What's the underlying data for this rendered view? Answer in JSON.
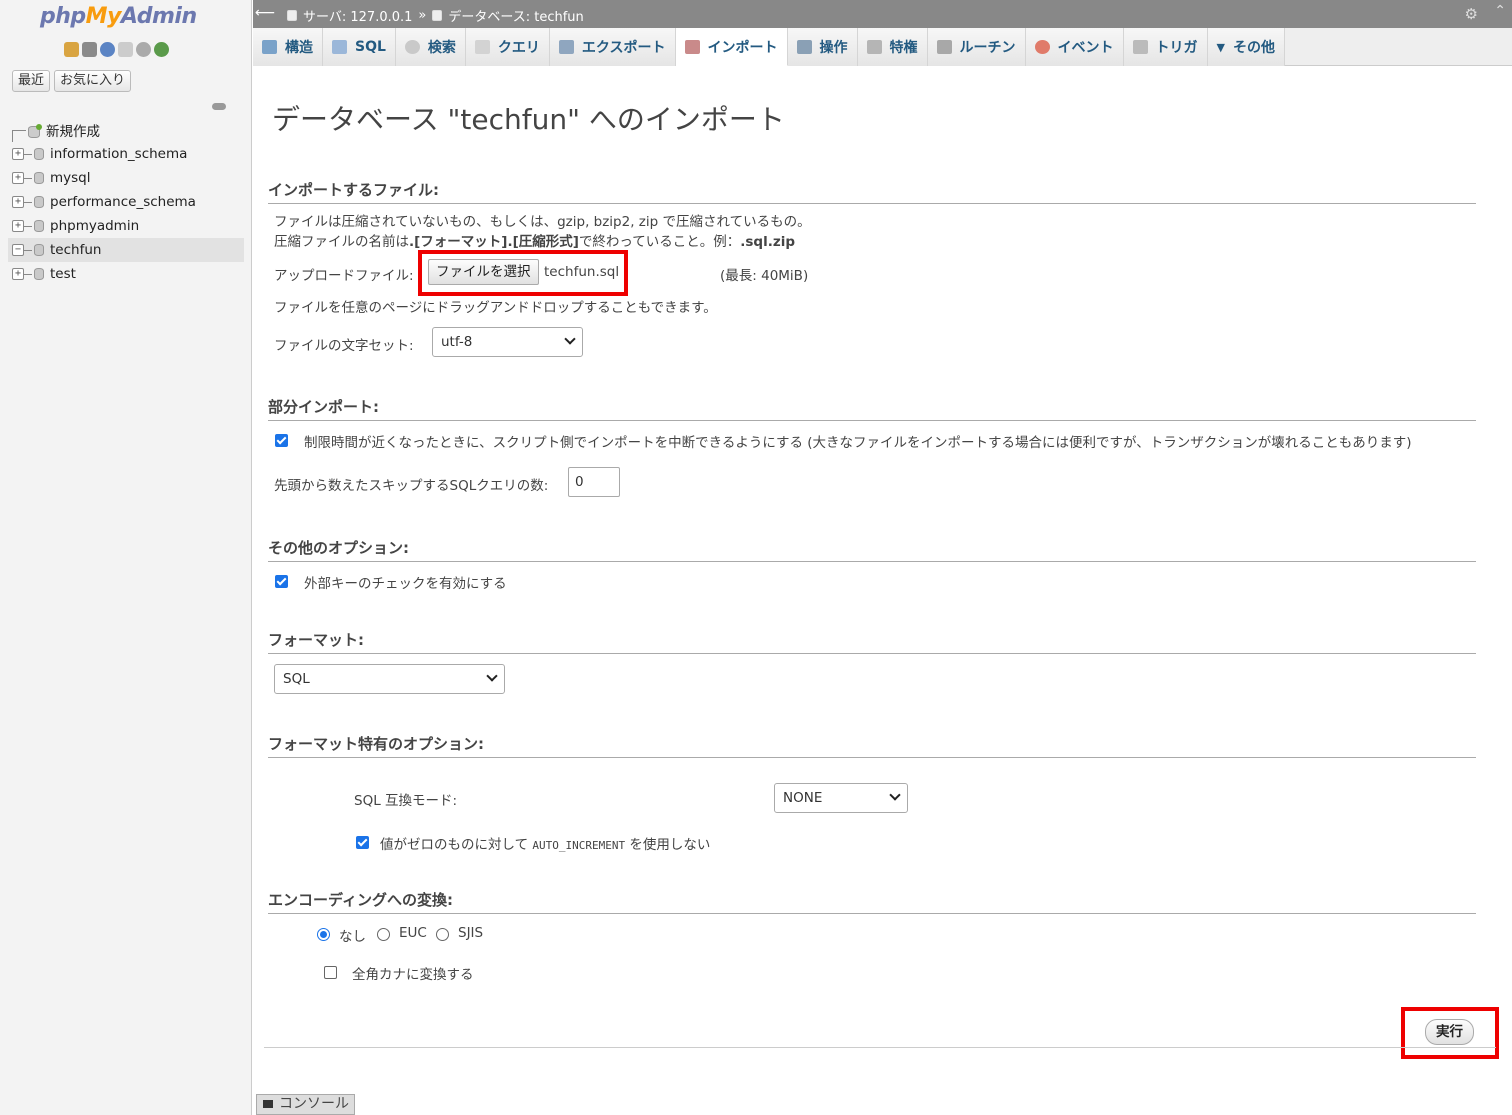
{
  "sidebar": {
    "logo": {
      "php": "php",
      "my": "My",
      "admin": "Admin"
    },
    "recent_label": "最近",
    "favorites_label": "お気に入り",
    "new_label": "新規作成",
    "databases": [
      {
        "name": "information_schema"
      },
      {
        "name": "mysql"
      },
      {
        "name": "performance_schema"
      },
      {
        "name": "phpmyadmin"
      },
      {
        "name": "techfun",
        "selected": true
      },
      {
        "name": "test"
      }
    ]
  },
  "topbar": {
    "server": "サーバ: 127.0.0.1",
    "separator": "»",
    "database": "データベース: techfun"
  },
  "menu": {
    "structure": "構造",
    "sql": "SQL",
    "search": "検索",
    "query": "クエリ",
    "export": "エクスポート",
    "import": "インポート",
    "operations": "操作",
    "privileges": "特権",
    "routines": "ルーチン",
    "events": "イベント",
    "triggers": "トリガ",
    "more": "その他"
  },
  "main": {
    "title": "データベース \"techfun\" へのインポート",
    "file_section": {
      "title": "インポートするファイル:",
      "desc1": "ファイルは圧縮されていないもの、もしくは、gzip, bzip2, zip で圧縮されているもの。",
      "desc2_prefix": "圧縮ファイルの名前は",
      "desc2_bold": ".[フォーマット].[圧縮形式]",
      "desc2_mid": "で終わっていること。例：",
      "desc2_example": ".sql.zip",
      "upload_label": "アップロードファイル:",
      "choose_button": "ファイルを選択",
      "chosen_file": "techfun.sql",
      "max_size": "(最長: 40MiB)",
      "drag_hint": "ファイルを任意のページにドラッグアンドドロップすることもできます。",
      "charset_label": "ファイルの文字セット:",
      "charset_value": "utf-8"
    },
    "partial_section": {
      "title": "部分インポート:",
      "interrupt_label": "制限時間が近くなったときに、スクリプト側でインポートを中断できるようにする (大きなファイルをインポートする場合には便利ですが、トランザクションが壊れることもあります)",
      "interrupt_checked": true,
      "skip_label": "先頭から数えたスキップするSQLクエリの数:",
      "skip_value": "0"
    },
    "other_section": {
      "title": "その他のオプション:",
      "fk_label": "外部キーのチェックを有効にする",
      "fk_checked": true
    },
    "format_section": {
      "title": "フォーマット:",
      "format_value": "SQL"
    },
    "format_options": {
      "title": "フォーマット特有のオプション:",
      "compat_label": "SQL 互換モード:",
      "compat_value": "NONE",
      "autoinc_prefix": "値がゼロのものに対して",
      "autoinc_code": "AUTO_INCREMENT",
      "autoinc_suffix": "を使用しない",
      "autoinc_checked": true
    },
    "encoding_section": {
      "title": "エンコーディングへの変換:",
      "options": [
        "なし",
        "EUC",
        "SJIS"
      ],
      "selected": "なし",
      "kana_label": "全角カナに変換する",
      "kana_checked": false
    },
    "go_button": "実行"
  },
  "console_label": "コンソール",
  "colors": {
    "highlight": "#ee0000",
    "tab_text": "#235a81",
    "topbar": "#888888",
    "checkbox": "#1a73e8"
  }
}
